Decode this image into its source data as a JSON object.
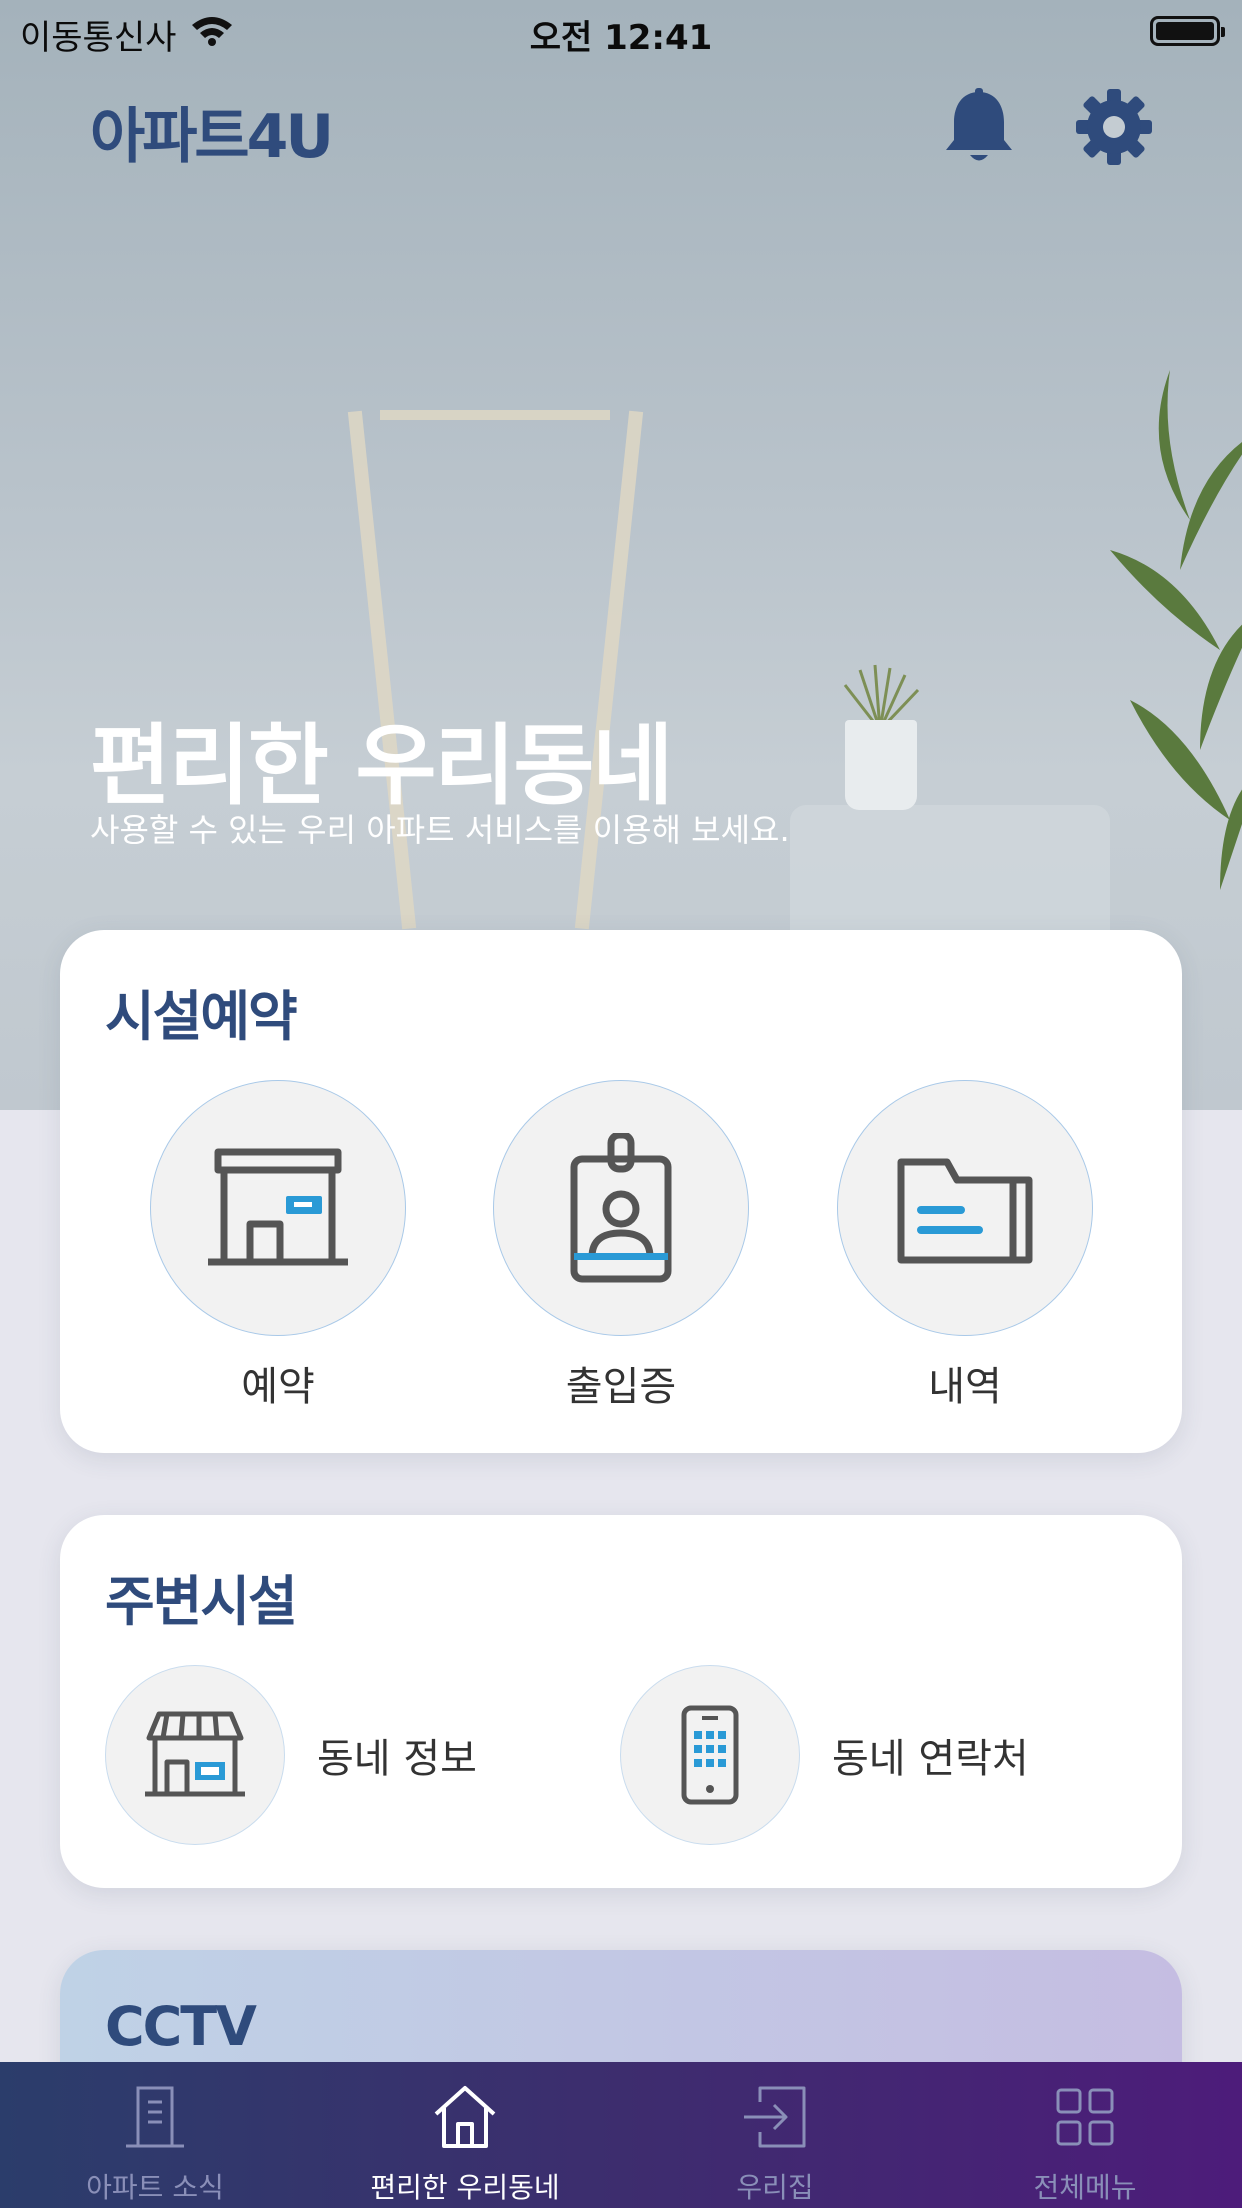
{
  "status_bar": {
    "carrier": "이동통신사",
    "time": "오전 12:41"
  },
  "header": {
    "logo": "아파트4U",
    "icons": [
      "bell-icon",
      "gear-icon"
    ],
    "accent_color": "#2f4b7c"
  },
  "hero": {
    "title": "편리한 우리동네",
    "subtitle": "사용할 수 있는 우리 아파트 서비스를 이용해 보세요."
  },
  "facility_booking": {
    "title": "시설예약",
    "items": [
      {
        "label": "예약",
        "icon": "building-icon"
      },
      {
        "label": "출입증",
        "icon": "id-badge-icon"
      },
      {
        "label": "내역",
        "icon": "folder-icon"
      }
    ]
  },
  "nearby": {
    "title": "주변시설",
    "items": [
      {
        "label": "동네 정보",
        "icon": "store-icon"
      },
      {
        "label": "동네 연락처",
        "icon": "phone-icon"
      }
    ]
  },
  "cctv": {
    "title": "CCTV"
  },
  "tab_bar": {
    "active_index": 1,
    "tabs": [
      {
        "label": "아파트 소식",
        "icon": "apartment-icon"
      },
      {
        "label": "편리한 우리동네",
        "icon": "home-icon"
      },
      {
        "label": "우리집",
        "icon": "enter-icon"
      },
      {
        "label": "전체메뉴",
        "icon": "grid-icon"
      }
    ]
  }
}
